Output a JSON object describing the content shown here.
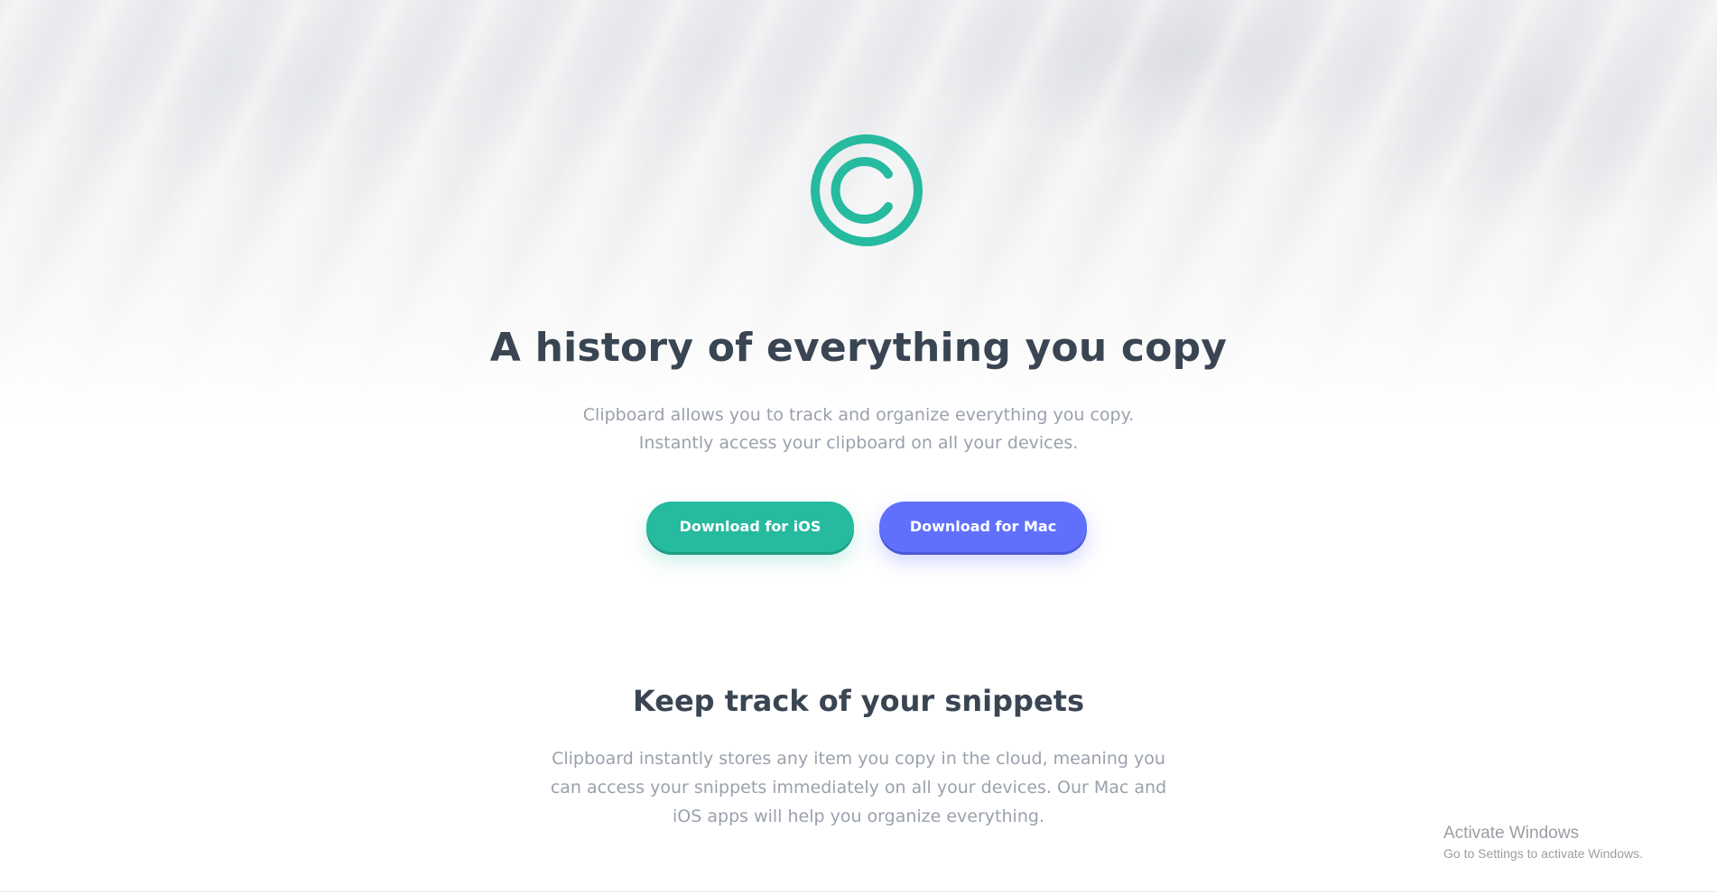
{
  "hero": {
    "logo_icon": "copyright-c-icon",
    "logo_color": "#26ba9f",
    "title": "A history of everything you copy",
    "text": "Clipboard allows you to track and organize everything you copy. Instantly access your clipboard on all your devices.",
    "buttons": {
      "ios_label": "Download for iOS",
      "mac_label": "Download for Mac",
      "ios_color": "#26ba9f",
      "mac_color": "#6070fd"
    }
  },
  "snippets": {
    "title": "Keep track of your snippets",
    "text": "Clipboard instantly stores any item you copy in the cloud, meaning you can access your snippets immediately on all your devices. Our Mac and iOS apps will help you organize everything."
  },
  "system_overlay": {
    "title": "Activate Windows",
    "subtitle": "Go to Settings to activate Windows."
  },
  "colors": {
    "heading": "#3a4553",
    "body_text": "#9aa1ac"
  }
}
